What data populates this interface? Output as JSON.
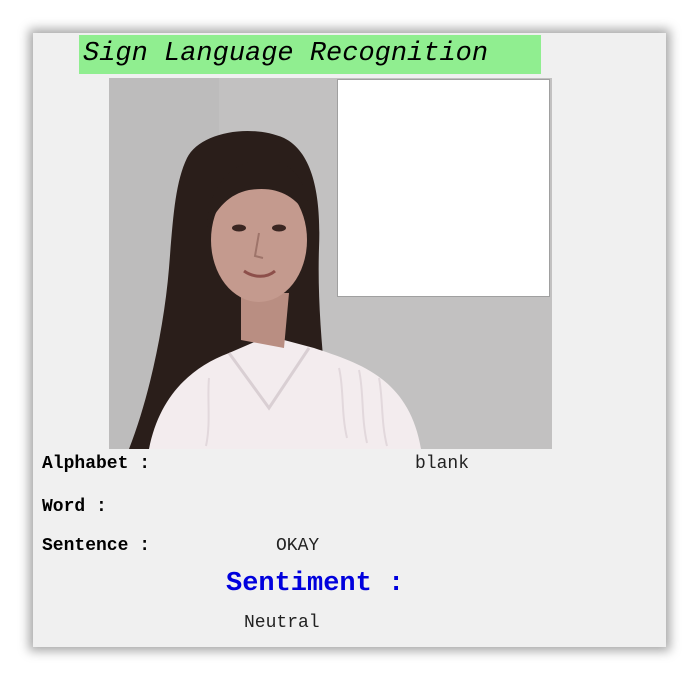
{
  "app": {
    "title": "Sign Language Recognition"
  },
  "fields": {
    "alphabet_label": "Alphabet :",
    "alphabet_value": "blank",
    "word_label": "Word :",
    "word_value": "",
    "sentence_label": "Sentence :",
    "sentence_value": "OKAY",
    "sentiment_label": "Sentiment :",
    "sentiment_value": "Neutral"
  },
  "colors": {
    "title_bg": "#90ee90",
    "sentiment_label": "#0000dd",
    "window_bg": "#f0f0f0",
    "roi_box": "#ffffff"
  }
}
